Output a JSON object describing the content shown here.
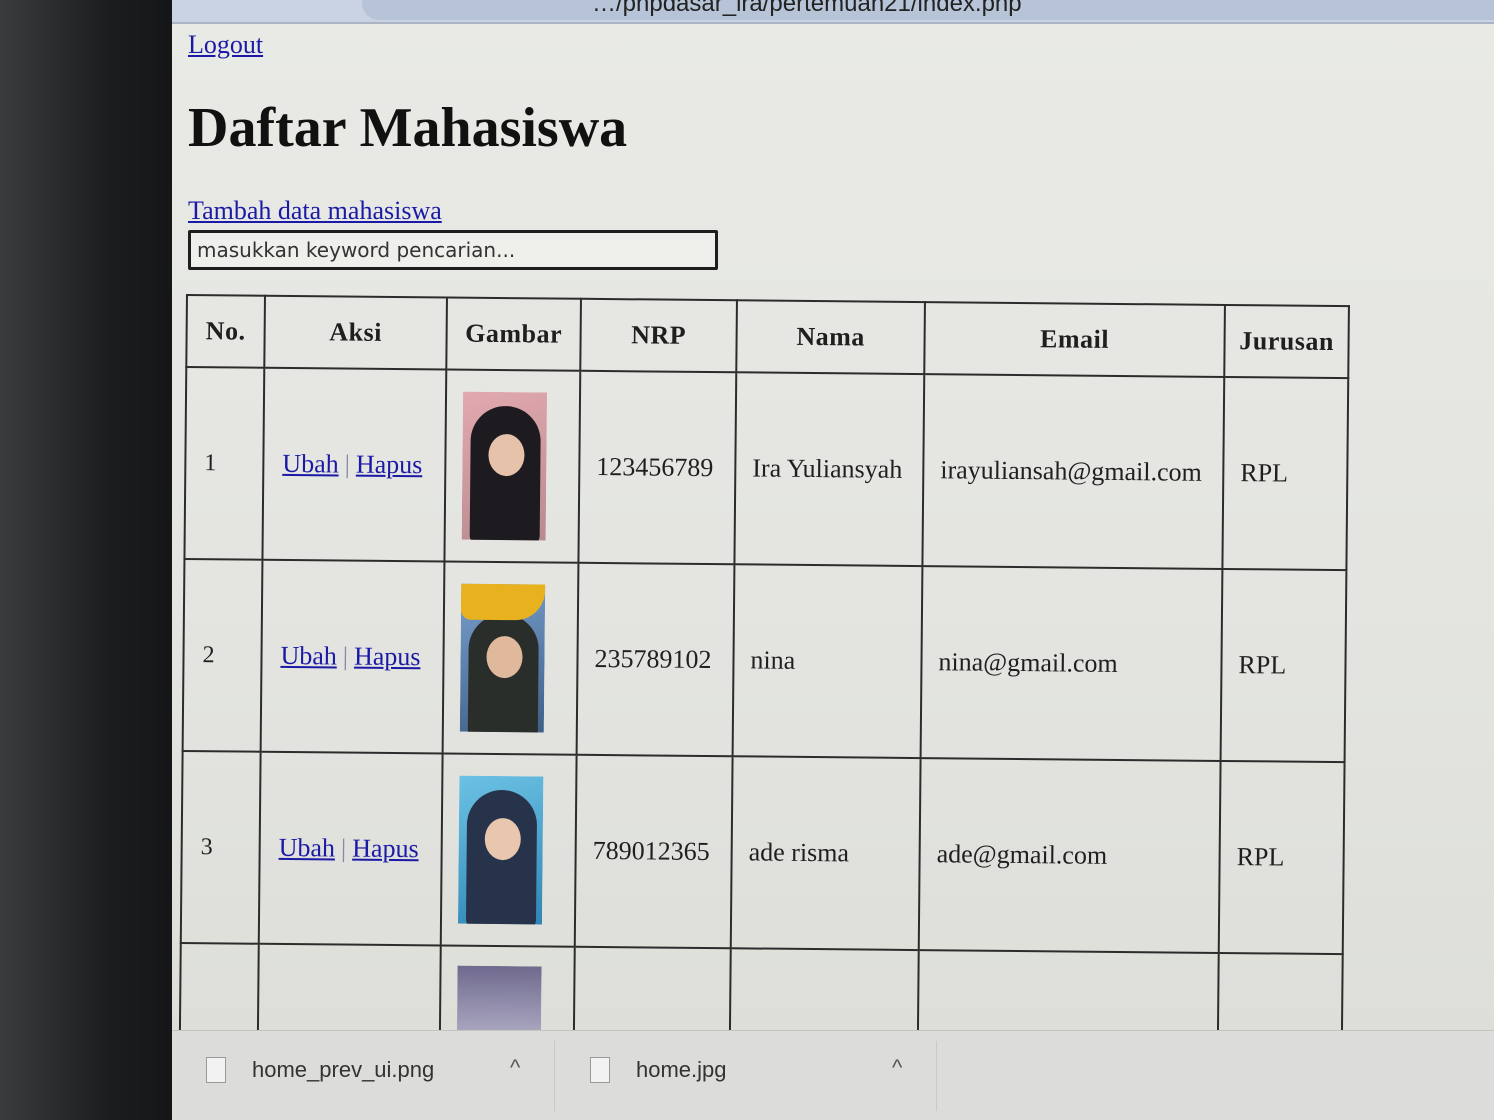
{
  "browser": {
    "url_fragment": "…/phpdasar_ira/pertemuan21/index.php"
  },
  "header": {
    "logout_label": "Logout",
    "title": "Daftar Mahasiswa",
    "add_label": "Tambah data mahasiswa"
  },
  "search": {
    "placeholder": "masukkan keyword pencarian..."
  },
  "table": {
    "columns": [
      "No.",
      "Aksi",
      "Gambar",
      "NRP",
      "Nama",
      "Email",
      "Jurusan"
    ],
    "rows": [
      {
        "no": "1",
        "edit_label": "Ubah",
        "separator": "|",
        "delete_label": "Hapus",
        "nrp": "123456789",
        "nama": "Ira Yuliansyah",
        "email": "irayuliansah@gmail.com",
        "jurusan": "RPL",
        "photo": {
          "bg": "#d8a0a6",
          "hijab": "#1d1b1f",
          "face": "#e6c2aa"
        }
      },
      {
        "no": "2",
        "edit_label": "Ubah",
        "separator": "|",
        "delete_label": "Hapus",
        "nrp": "235789102",
        "nama": "nina",
        "email": "nina@gmail.com",
        "jurusan": "RPL",
        "photo": {
          "bg": "#6a8fc0",
          "hijab": "#2a2e2a",
          "face": "#e0b89c",
          "hat": "#e7b21e"
        }
      },
      {
        "no": "3",
        "edit_label": "Ubah",
        "separator": "|",
        "delete_label": "Hapus",
        "nrp": "789012365",
        "nama": "ade risma",
        "email": "ade@gmail.com",
        "jurusan": "RPL",
        "photo": {
          "bg": "#4aa9cf",
          "hijab": "#26334a",
          "face": "#e8c7ae"
        }
      }
    ]
  },
  "downloads": {
    "items": [
      {
        "name": "home_prev_ui.png",
        "icon": "image-file-icon"
      },
      {
        "name": "home.jpg",
        "icon": "image-file-icon"
      }
    ],
    "chevron": "^"
  }
}
